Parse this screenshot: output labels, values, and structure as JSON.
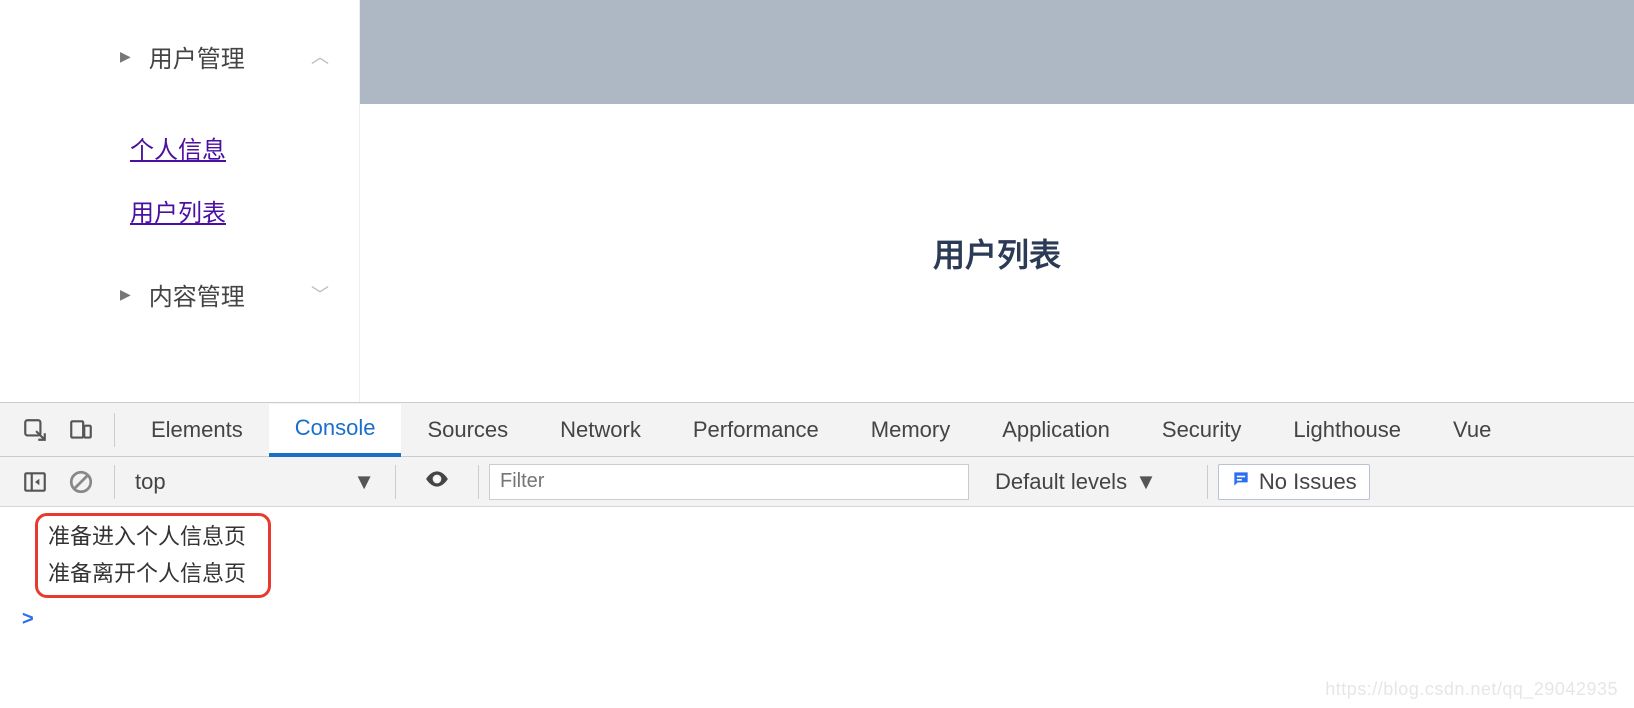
{
  "sidebar": {
    "items": [
      {
        "label": "用户管理",
        "expanded": true,
        "children": [
          {
            "label": "个人信息"
          },
          {
            "label": "用户列表"
          }
        ]
      },
      {
        "label": "内容管理",
        "expanded": false
      }
    ]
  },
  "page": {
    "title": "用户列表"
  },
  "devtools": {
    "tabs": [
      "Elements",
      "Console",
      "Sources",
      "Network",
      "Performance",
      "Memory",
      "Application",
      "Security",
      "Lighthouse",
      "Vue"
    ],
    "active_tab": "Console",
    "toolbar": {
      "context": "top",
      "filter_placeholder": "Filter",
      "levels": "Default levels",
      "issues": "No Issues"
    },
    "console": {
      "lines": [
        "准备进入个人信息页",
        "准备离开个人信息页"
      ],
      "prompt": ">"
    }
  },
  "watermark": "https://blog.csdn.net/qq_29042935"
}
